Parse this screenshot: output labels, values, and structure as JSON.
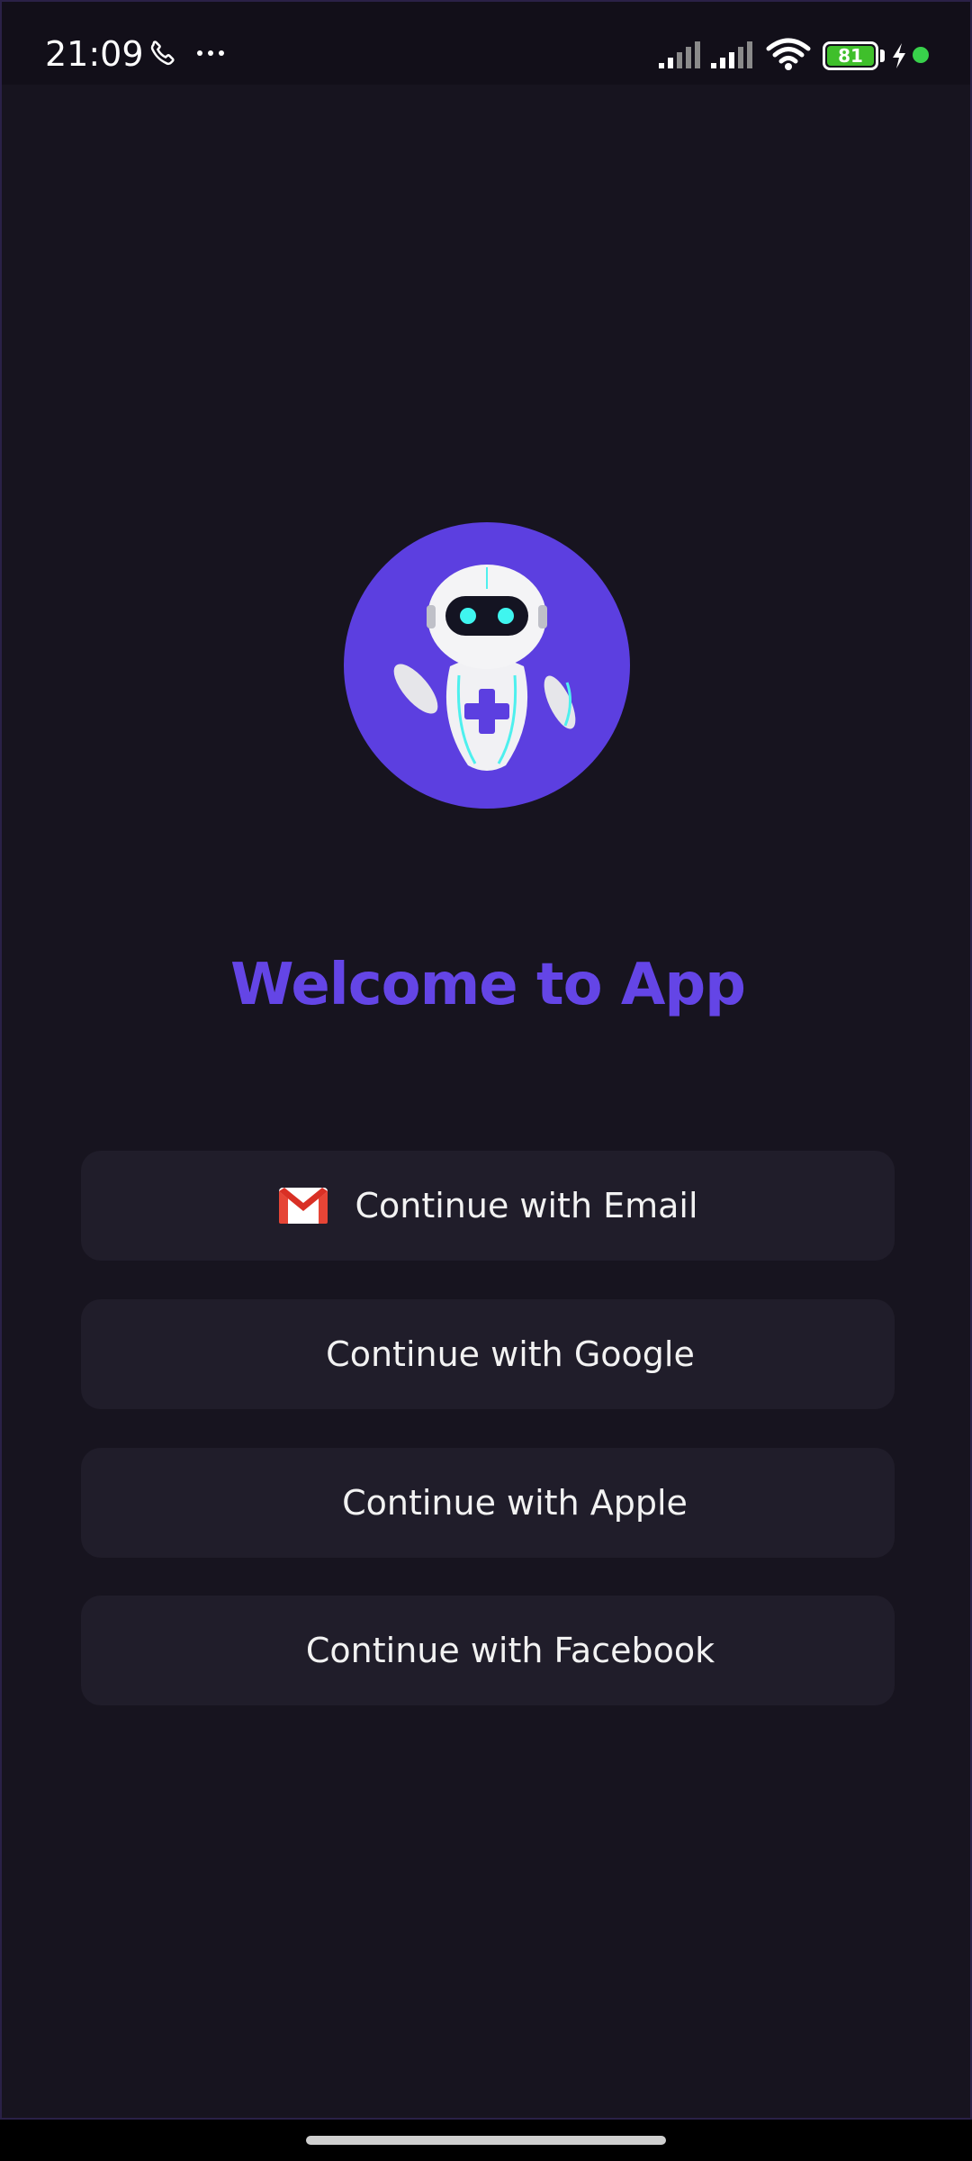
{
  "status_bar": {
    "time": "21:09",
    "battery_level": "81",
    "icons": [
      "phone-icon",
      "more-icon",
      "signal-icon",
      "signal-icon",
      "wifi-icon",
      "battery-icon",
      "charging-bolt-icon",
      "notification-dot"
    ]
  },
  "welcome": {
    "title": "Welcome to App",
    "logo": "robot-logo-icon"
  },
  "buttons": {
    "email": "Continue with Email",
    "google": "Continue with Google",
    "apple": "Continue with Apple",
    "facebook": "Continue with Facebook"
  },
  "colors": {
    "background": "#17141f",
    "accent": "#6445e6",
    "button_bg": "#201d2a",
    "logo_bg": "#5c3fe0"
  }
}
